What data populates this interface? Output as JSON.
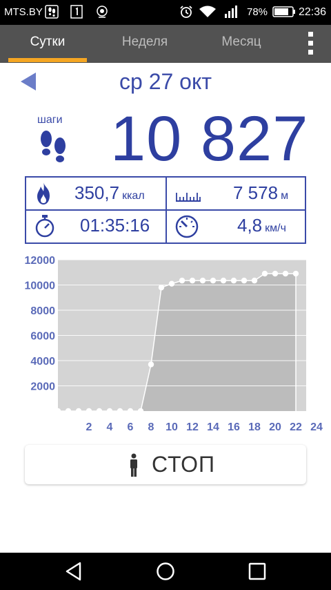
{
  "status_bar": {
    "carrier": "MTS.BY",
    "battery_percent": "78%",
    "time": "22:36",
    "icons": [
      "footsteps-notification-icon",
      "sim-1-icon",
      "location-notification-icon",
      "alarm-icon",
      "wifi-icon",
      "signal-icon",
      "battery-icon"
    ]
  },
  "tabs": [
    {
      "label": "Сутки",
      "active": true
    },
    {
      "label": "Неделя",
      "active": false
    },
    {
      "label": "Месяц",
      "active": false
    }
  ],
  "header": {
    "date": "ср 27 окт"
  },
  "steps": {
    "label": "шаги",
    "value": "10 827"
  },
  "stats": {
    "calories": {
      "value": "350,7",
      "unit": "ккал",
      "icon": "flame-icon"
    },
    "distance": {
      "value": "7 578",
      "unit": "м",
      "icon": "ruler-icon"
    },
    "duration": {
      "value": "01:35:16",
      "icon": "stopwatch-icon"
    },
    "speed": {
      "value": "4,8",
      "unit": "км/ч",
      "icon": "speedometer-icon"
    }
  },
  "accent_color": "#2e3fa0",
  "tab_indicator_color": "#f5a623",
  "chart_data": {
    "type": "area",
    "x": [
      0,
      1,
      2,
      3,
      4,
      5,
      6,
      7,
      8,
      9,
      10,
      11,
      12,
      13,
      14,
      15,
      16,
      17,
      18,
      19,
      20,
      21,
      22,
      23
    ],
    "values": [
      0,
      0,
      0,
      0,
      0,
      0,
      0,
      0,
      0,
      3700,
      9800,
      10100,
      10350,
      10350,
      10350,
      10350,
      10350,
      10350,
      10350,
      10350,
      10900,
      10900,
      10900,
      10900
    ],
    "xlim": [
      0,
      24
    ],
    "ylim": [
      0,
      12000
    ],
    "x_tick_labels": [
      "2",
      "4",
      "6",
      "8",
      "10",
      "12",
      "14",
      "16",
      "18",
      "20",
      "22",
      "24"
    ],
    "x_ticks": [
      2,
      4,
      6,
      8,
      10,
      12,
      14,
      16,
      18,
      20,
      22,
      24
    ],
    "y_tick_labels": [
      "2000",
      "4000",
      "6000",
      "8000",
      "10000",
      "12000"
    ],
    "y_ticks": [
      2000,
      4000,
      6000,
      8000,
      10000,
      12000
    ],
    "grid": true,
    "colors": {
      "fill": "#bcbcbc",
      "background": "#d4d4d4",
      "line": "#ffffff",
      "labels": "#5a6ab8"
    }
  },
  "stop_button": {
    "label": "СТОП",
    "icon": "person-icon"
  },
  "nav_bar": {
    "buttons": [
      "back-icon",
      "home-icon",
      "recents-icon"
    ]
  }
}
